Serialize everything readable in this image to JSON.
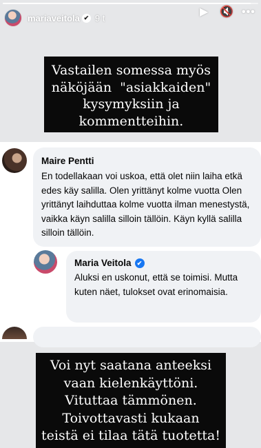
{
  "story": {
    "progress": 0.97,
    "username": "mariaveitola",
    "verified_glyph": "✔",
    "time_ago": "9 t",
    "icons": [
      "play-icon",
      "mute-icon",
      "more-icon"
    ],
    "icon_glyphs": {
      "play": "▶",
      "mute": "🔇",
      "more": "•••"
    }
  },
  "caption_top": {
    "lines": [
      "Vastailen somessa myös",
      "näköjään  \"asiakkaiden\"",
      "kysymyksiin ja",
      "kommentteihin."
    ]
  },
  "comments": [
    {
      "author": "Maire Pentti",
      "verified": false,
      "text": "En todellakaan voi uskoa, että olet niin laiha etkä edes käy salilla. Olen yrittänyt kolme vuotta Olen yrittänyt laihduttaa kolme vuotta ilman menestystä, vaikka käyn salilla silloin tällöin. Käyn kyllä salilla silloin tällöin."
    },
    {
      "author": "Maria Veitola",
      "verified": true,
      "verified_glyph": "✔",
      "text": "Aluksi en uskonut, että se toimisi. Mutta kuten näet, tulokset ovat erinomaisia."
    }
  ],
  "caption_bottom": {
    "lines": [
      "Voi nyt saatana anteeksi",
      "vaan kielenkäyttöni.",
      "Vituttaa tämmönen.",
      "Toivottavasti kukaan",
      "teistä ei tilaa tätä tuotetta!"
    ]
  },
  "colors": {
    "background": "#e6e7e9",
    "bubble": "#f0f2f5",
    "caption_bg": "#0a0a0a",
    "verified_blue": "#1877f2"
  }
}
